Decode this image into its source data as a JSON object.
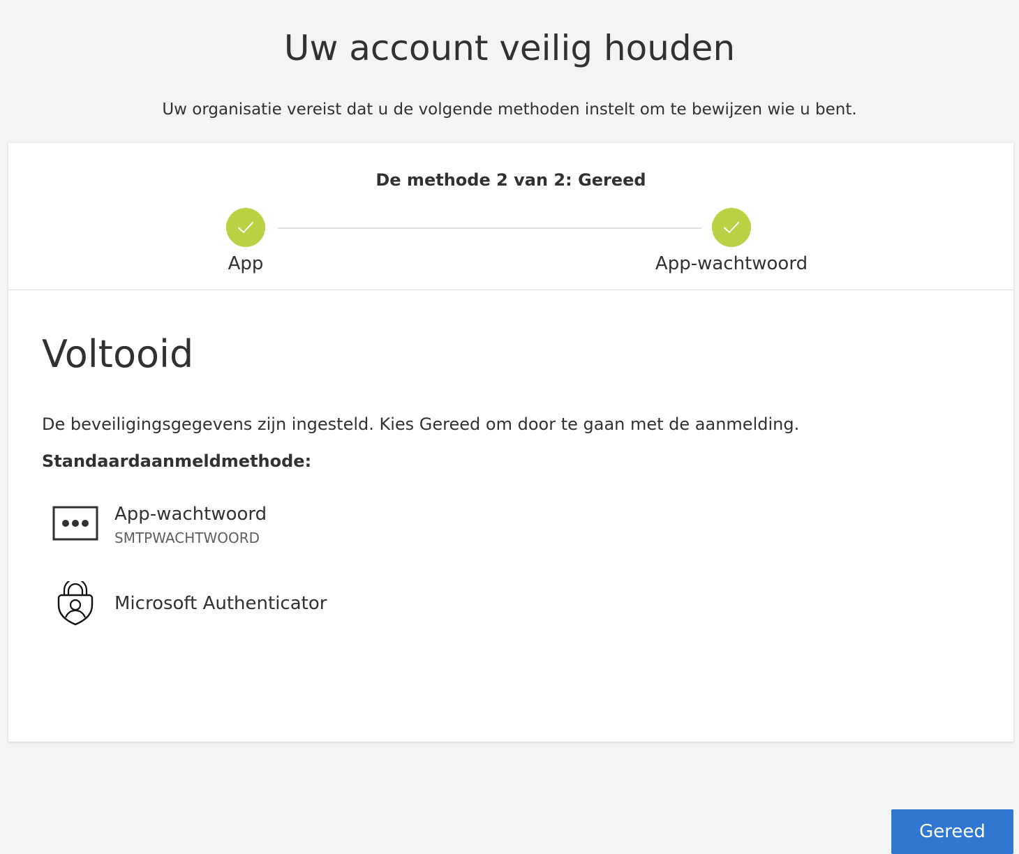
{
  "page": {
    "title": "Uw account veilig houden",
    "subtitle": "Uw organisatie vereist dat u de volgende methoden instelt om te bewijzen wie u bent."
  },
  "progress": {
    "title": "De methode 2 van 2: Gereed",
    "steps": [
      {
        "label": "App",
        "status": "completed"
      },
      {
        "label": "App-wachtwoord",
        "status": "completed"
      }
    ],
    "completed_color": "#b9d244"
  },
  "content": {
    "title": "Voltooid",
    "description": "De beveiligingsgegevens zijn ingesteld. Kies Gereed om door te gaan met de aanmelding.",
    "default_method_label": "Standaardaanmeldmethode:",
    "methods": [
      {
        "name": "App-wachtwoord",
        "detail": "SMTPWACHTWOORD",
        "icon": "password-dots-icon"
      },
      {
        "name": "Microsoft Authenticator",
        "icon": "authenticator-icon"
      }
    ]
  },
  "actions": {
    "done_label": "Gereed",
    "primary_color": "#2f77d1"
  }
}
